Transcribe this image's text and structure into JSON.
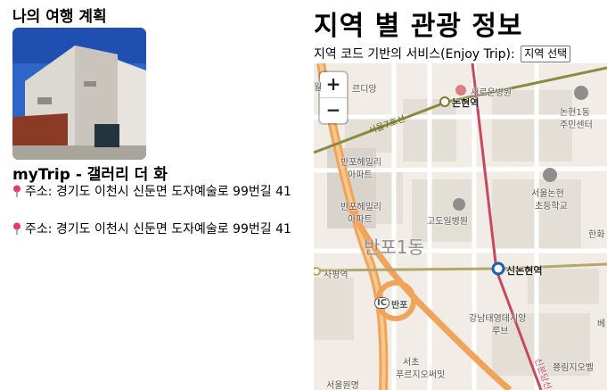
{
  "left": {
    "section_title": "나의 여행 계획",
    "trip_name": "myTrip - 갤러리 더 화",
    "addresses": [
      {
        "text": "주소: 경기도 이천시 신둔면 도자예술로 99번길 41"
      },
      {
        "text": "주소: 경기도 이천시 신둔면 도자예술로 99번길 41"
      }
    ]
  },
  "right": {
    "title": "지역 별 관광 정보",
    "service_label": "지역 코드 기반의 서비스(Enjoy Trip):",
    "region_select": "지역 선택"
  },
  "map": {
    "zoom_in": "+",
    "zoom_out": "−",
    "labels": {
      "l1": "월",
      "l2": "르디앙",
      "l3": "새로운병원",
      "l4": "논현역",
      "l5": "논현1동",
      "l6": "주민센터",
      "l7": "서울7호선",
      "l8": "반포헤밀리",
      "l9": "아파트",
      "l10": "서울논현",
      "l11": "초등학교",
      "l12": "반포헤밀리",
      "l13": "아파트",
      "l14": "고도일병원",
      "l15": "반포1동",
      "l16": "한화",
      "l17": "사평역",
      "l18": "신논현역",
      "l19": "IC",
      "l20": "반포",
      "l21": "강남태영데시앙",
      "l22": "루브",
      "l23": "베",
      "l24": "서초",
      "l25": "푸르지오써밋",
      "l26": "서울원명",
      "l27": "쭁림지오벨",
      "l28": "신분당선"
    }
  },
  "colors": {
    "pin": "#e8357b",
    "subway_line7": "#7f7d33",
    "subway_line9": "#b5a66a",
    "sinbundang": "#c7495f",
    "highway": "#f0a35b"
  }
}
